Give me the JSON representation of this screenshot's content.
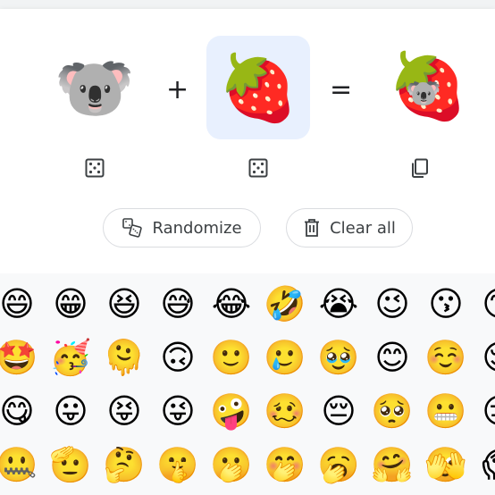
{
  "mixer": {
    "left": {
      "emoji": "🐨",
      "name": "koala"
    },
    "right": {
      "emoji": "🍓",
      "name": "strawberry"
    },
    "result": {
      "emoji": "🍓",
      "overlay": "🐨",
      "name": "koala-strawberry mix"
    },
    "plus_symbol": "+",
    "equals_symbol": "=",
    "icons": {
      "left_random": "dice-icon",
      "right_random": "dice-icon",
      "result_copy": "copy-icon"
    }
  },
  "actions": {
    "randomize_label": "Randomize",
    "clear_label": "Clear all"
  },
  "emoji_grid": [
    [
      "😄",
      "😁",
      "😆",
      "😅",
      "😂",
      "🤣",
      "😭",
      "😉",
      "😗",
      "😙"
    ],
    [
      "🤩",
      "🥳",
      "🫠",
      "🙃",
      "🙂",
      "🥲",
      "🥹",
      "😊",
      "☺️",
      "😌"
    ],
    [
      "😋",
      "😛",
      "😝",
      "😜",
      "🤪",
      "🥴",
      "😔",
      "🥺",
      "😬",
      "😑"
    ],
    [
      "🤐",
      "🫡",
      "🤔",
      "🤫",
      "🫢",
      "🤭",
      "🥱",
      "🤗",
      "🫣",
      "😱"
    ]
  ],
  "colors": {
    "selected_bg": "#e8f0fe",
    "border": "#dadce0",
    "text": "#3c4043"
  }
}
